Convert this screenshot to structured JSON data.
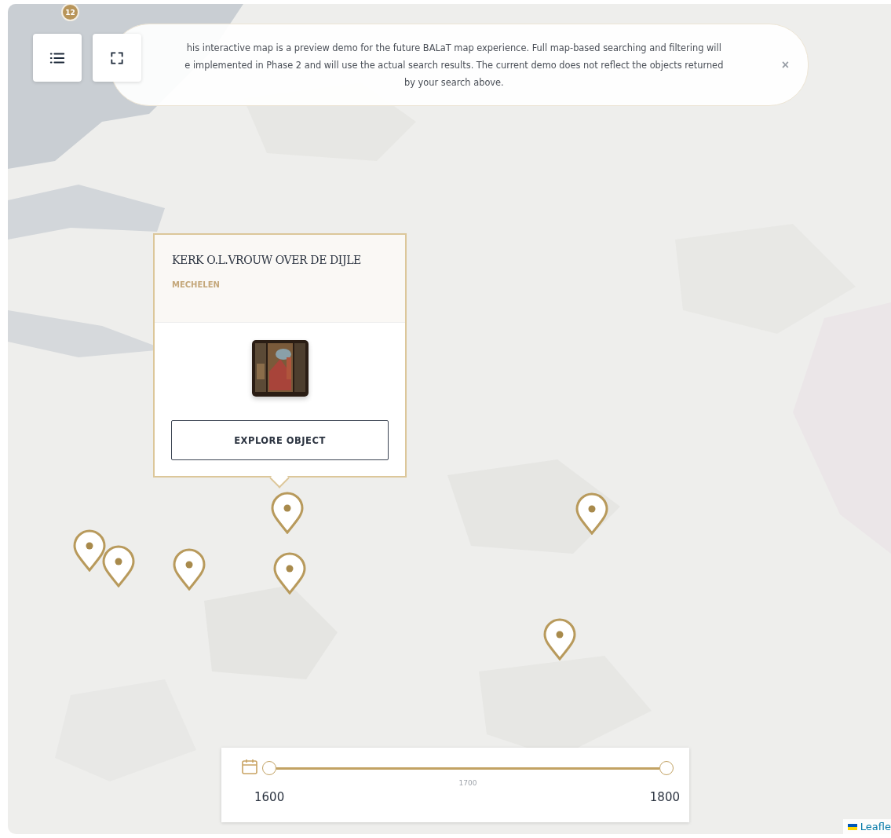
{
  "controls": {
    "list_badge": "12"
  },
  "notice": {
    "lines": [
      "his interactive map is a preview demo for the future BALaT map experience. Full map-based searching and filtering will",
      "e implemented in Phase 2 and will use the actual search results. The current demo does not reflect the objects returned",
      "by your search above."
    ],
    "close": "×"
  },
  "popup": {
    "title": "KERK O.L.VROUW OVER DE DIJLE",
    "subtitle": "MECHELEN",
    "button": "EXPLORE OBJECT"
  },
  "timeline": {
    "start_label": "1600",
    "end_label": "1800",
    "mid_label": "1700",
    "start": {
      "level": 0
    },
    "end": {
      "level": 1
    }
  },
  "attribution": "Leafle"
}
